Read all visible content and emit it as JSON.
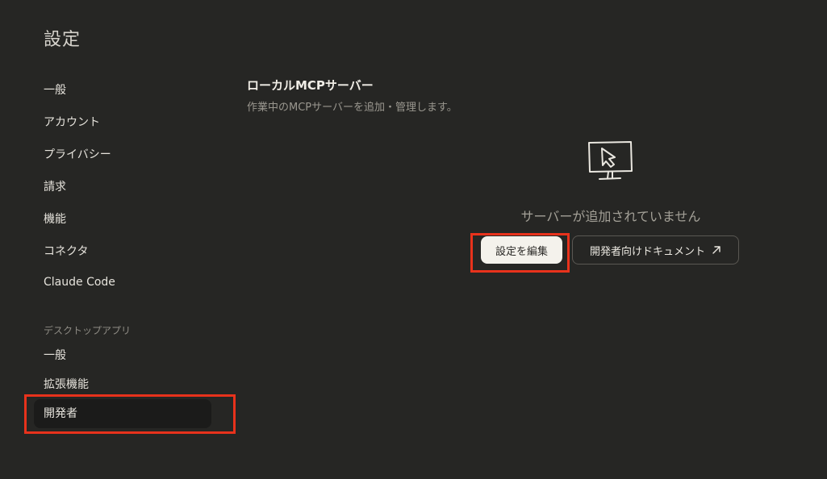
{
  "header": {
    "title": "設定"
  },
  "sidebar": {
    "items": [
      {
        "label": "一般"
      },
      {
        "label": "アカウント"
      },
      {
        "label": "プライバシー"
      },
      {
        "label": "請求"
      },
      {
        "label": "機能"
      },
      {
        "label": "コネクタ"
      },
      {
        "label": "Claude Code"
      }
    ],
    "desktop_section_label": "デスクトップアプリ",
    "desktop_items": [
      {
        "label": "一般"
      },
      {
        "label": "拡張機能"
      },
      {
        "label": "開発者"
      }
    ],
    "active_item": "開発者"
  },
  "main": {
    "section_title": "ローカルMCPサーバー",
    "section_description": "作業中のMCPサーバーを追加・管理します。",
    "empty_state_text": "サーバーが追加されていません",
    "edit_config_button": "設定を編集",
    "developer_docs_button": "開発者向けドキュメント"
  },
  "icons": {
    "empty_state": "monitor-cursor-icon",
    "external_link": "arrow-up-right-icon"
  },
  "colors": {
    "background": "#262624",
    "highlight": "#e8321c",
    "primary_button_bg": "#f4f2ec",
    "active_item_bg": "#1b1b1a"
  }
}
